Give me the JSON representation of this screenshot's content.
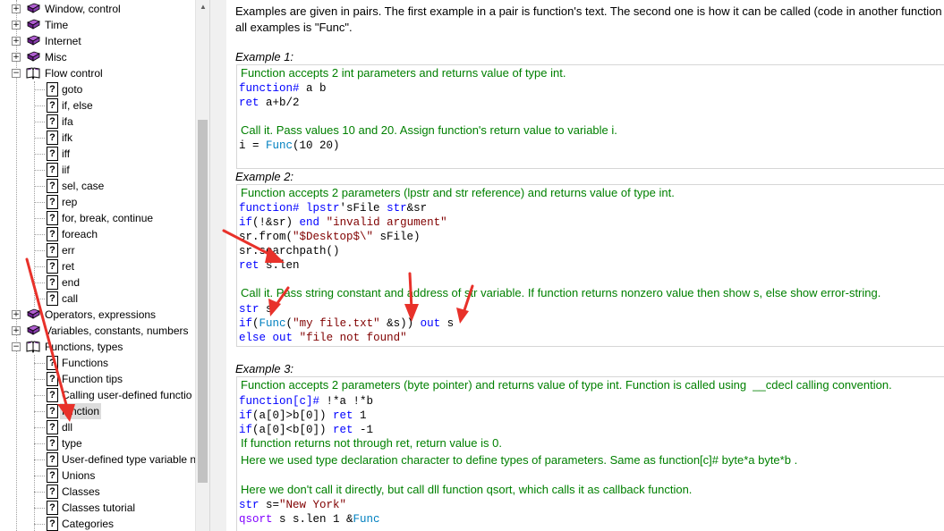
{
  "tree": {
    "items": [
      {
        "label": "Window, control",
        "type": "book",
        "state": "collapsed"
      },
      {
        "label": "Time",
        "type": "book",
        "state": "collapsed"
      },
      {
        "label": "Internet",
        "type": "book",
        "state": "collapsed"
      },
      {
        "label": "Misc",
        "type": "book",
        "state": "collapsed"
      },
      {
        "label": "Flow control",
        "type": "book",
        "state": "expanded"
      },
      {
        "label": "goto",
        "type": "page"
      },
      {
        "label": "if, else",
        "type": "page"
      },
      {
        "label": "ifa",
        "type": "page"
      },
      {
        "label": "ifk",
        "type": "page"
      },
      {
        "label": "iff",
        "type": "page"
      },
      {
        "label": "iif",
        "type": "page"
      },
      {
        "label": "sel, case",
        "type": "page"
      },
      {
        "label": "rep",
        "type": "page"
      },
      {
        "label": "for, break, continue",
        "type": "page"
      },
      {
        "label": "foreach",
        "type": "page"
      },
      {
        "label": "err",
        "type": "page"
      },
      {
        "label": "ret",
        "type": "page"
      },
      {
        "label": "end",
        "type": "page"
      },
      {
        "label": "call",
        "type": "page"
      },
      {
        "label": "Operators, expressions",
        "type": "book",
        "state": "collapsed"
      },
      {
        "label": "Variables, constants, numbers",
        "type": "book",
        "state": "collapsed"
      },
      {
        "label": "Functions, types",
        "type": "book",
        "state": "expanded"
      },
      {
        "label": "Functions",
        "type": "page"
      },
      {
        "label": "Function tips",
        "type": "page"
      },
      {
        "label": "Calling user-defined functio",
        "type": "page"
      },
      {
        "label": "function",
        "type": "page",
        "selected": true
      },
      {
        "label": "dll",
        "type": "page"
      },
      {
        "label": "type",
        "type": "page"
      },
      {
        "label": "User-defined type variable n",
        "type": "page"
      },
      {
        "label": "Unions",
        "type": "page"
      },
      {
        "label": "Classes",
        "type": "page"
      },
      {
        "label": "Classes tutorial",
        "type": "page"
      },
      {
        "label": "Categories",
        "type": "page"
      }
    ]
  },
  "content": {
    "intro_line1": "Examples are given in pairs. The first example in a pair is function's text. The second one is how it can be called (code in another function",
    "intro_line2": "all examples is \"Func\".",
    "examples": [
      {
        "title": "Example 1:",
        "comment1": "Function accepts 2 int parameters and returns value of type int.",
        "code": [
          "function# a b",
          "ret a+b/2"
        ],
        "comment2": "Call it. Pass values 10 and 20. Assign function's return value to variable i.",
        "call": [
          "i = Func(10 20)"
        ]
      },
      {
        "title": "Example 2:",
        "comment1": "Function accepts 2 parameters (lpstr and str reference) and returns value of type int.",
        "code": [
          "function# lpstr'sFile str&sr",
          "if(!&sr) end \"invalid argument\"",
          "sr.from(\"$Desktop$\\\" sFile)",
          "sr.searchpath()",
          "ret s.len"
        ],
        "comment2": "Call it. Pass string constant and address of str variable. If function returns nonzero value then show s, else show error-string.",
        "call": [
          "str s",
          "if(Func(\"my file.txt\" &s)) out s",
          "else out \"file not found\""
        ]
      },
      {
        "title": "Example 3:",
        "comment1": "Function accepts 2 parameters (byte pointer) and returns value of type int. Function is called using  __cdecl calling convention.",
        "code": [
          "function[c]# !*a !*b",
          "if(a[0]>b[0]) ret 1",
          "if(a[0]<b[0]) ret -1"
        ],
        "comment2": "If function returns not through ret, return value is 0.",
        "comment3": "Here we used type declaration character to define types of parameters. Same as function[c]# byte*a byte*b .",
        "comment4": "Here we don't call it directly, but call dll function qsort, which calls it as callback function.",
        "call": [
          "str s=\"New York\"",
          "qsort s s.len 1 &Func"
        ]
      }
    ]
  },
  "colors": {
    "comment": "#008000",
    "keyword": "#0000ff",
    "string": "#800000",
    "function_name": "#0080c0",
    "annotation_arrow": "#e8312a",
    "selection": "#dcdcdc"
  }
}
